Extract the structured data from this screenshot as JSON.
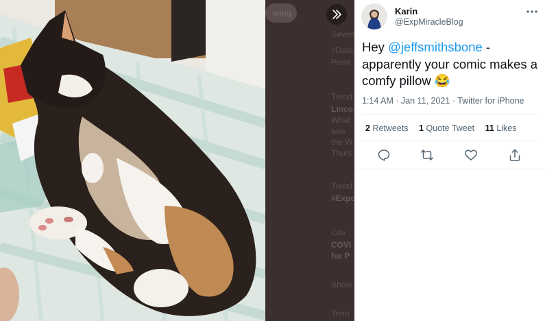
{
  "tweet": {
    "author_name": "Karin",
    "author_handle": "@ExpMiracleBlog",
    "text_prefix": "Hey ",
    "mention": "@jeffsmithsbone",
    "text_suffix": " - apparently your comic makes a comfy pillow",
    "emoji": "😂",
    "time": "1:14 AM",
    "date": "Jan 11, 2021",
    "source": "Twitter for iPhone",
    "retweets_count": "2",
    "retweets_label": "Retweets",
    "quotes_count": "1",
    "quotes_label": "Quote Tweet",
    "likes_count": "11",
    "likes_label": "Likes"
  },
  "background_timeline": {
    "follow_button": "wing",
    "items": [
      "Seven",
      "#Data",
      "Provi",
      "Trend",
      "Linco",
      "What",
      "was",
      "the W",
      "Thurs",
      "Trend",
      "#Expo",
      "Cov",
      "COVI",
      "for P",
      "Show",
      "Term"
    ]
  },
  "icons": {
    "expand": "chevron-double-right-icon",
    "more": "more-horizontal-icon",
    "reply": "reply-icon",
    "retweet": "retweet-icon",
    "like": "heart-icon",
    "share": "share-icon"
  },
  "colors": {
    "link": "#1d9bf0",
    "text": "#0f1419",
    "secondary": "#536471",
    "overlay": "#3b302e"
  }
}
